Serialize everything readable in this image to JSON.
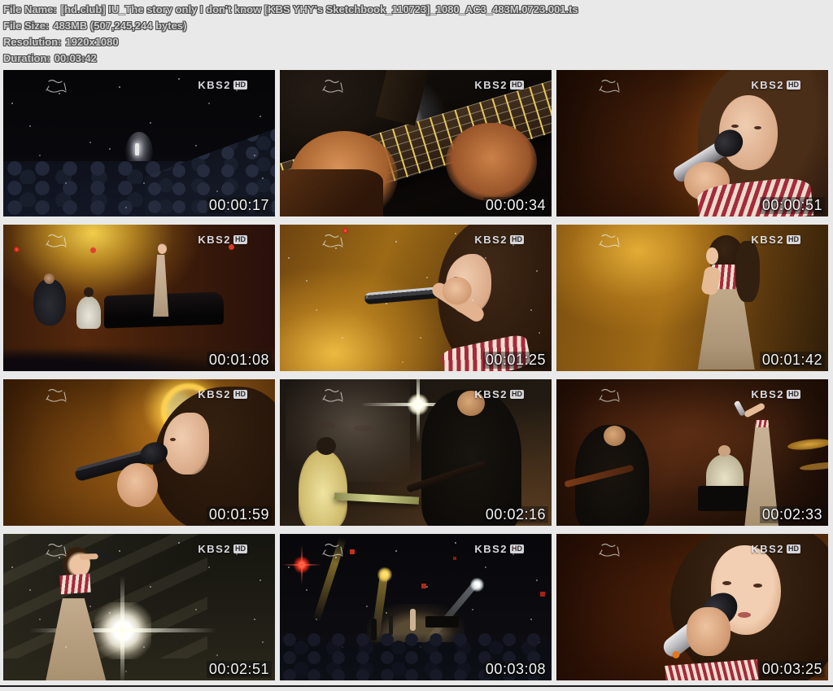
{
  "header": {
    "lines": [
      {
        "label": "File Name:",
        "value": "[hd.club] IU_The story only I don't know [KBS YHY's Sketchbook_110723]_1080_AC3_483M.0723.001.ts"
      },
      {
        "label": "File Size:",
        "value": "483MB (507,245,244 bytes)"
      },
      {
        "label": "Resolution:",
        "value": "1920x1080"
      },
      {
        "label": "Duration:",
        "value": "00:03:42"
      }
    ]
  },
  "overlay": {
    "channel": "KBS2",
    "hd_badge": "HD",
    "watermark": "handwritten Sketchbook program logo"
  },
  "colors": {
    "sheet_background": "#e9e9e9",
    "header_text_fill": "#cfcfcf",
    "header_text_outline": "#4d4d4d",
    "timestamp_text": "#f4f4f4",
    "stage_amber": "#a06b16",
    "channel_logo": "#e9e9ef"
  },
  "thumbnails": [
    {
      "timestamp": "00:00:17",
      "scene": "s1",
      "description": "dark wide shot of hall, tiny spotlit singer, audience silhouettes"
    },
    {
      "timestamp": "00:00:34",
      "scene": "s2",
      "description": "guitar fretboard close-up with both hands, round white light"
    },
    {
      "timestamp": "00:00:51",
      "scene": "s3",
      "description": "close-up singing into silver microphone, amber backdrop"
    },
    {
      "timestamp": "00:01:08",
      "scene": "s4",
      "description": "full stage with guitarist, pianist, grand piano and singer"
    },
    {
      "timestamp": "00:01:25",
      "scene": "s5",
      "description": "profile holding microphone sideways, golden starry backdrop"
    },
    {
      "timestamp": "00:01:42",
      "scene": "s6",
      "description": "standing side view in striped top and beige dress"
    },
    {
      "timestamp": "00:01:59",
      "scene": "s7",
      "description": "close-up profile with golden halo light behind head"
    },
    {
      "timestamp": "00:02:16",
      "scene": "s8",
      "description": "pianist in yellow shirt and bassist, starburst light, projected face"
    },
    {
      "timestamp": "00:02:33",
      "scene": "s9",
      "description": "bassist, pianist and singer in long beige dress on warm stage"
    },
    {
      "timestamp": "00:02:51",
      "scene": "s10",
      "description": "singer at left with large white starburst flare"
    },
    {
      "timestamp": "00:03:08",
      "scene": "s11",
      "description": "distant stage with yellow and white light beams over audience"
    },
    {
      "timestamp": "00:03:25",
      "scene": "s12",
      "description": "final close-up with silver microphone, amber backdrop"
    }
  ]
}
